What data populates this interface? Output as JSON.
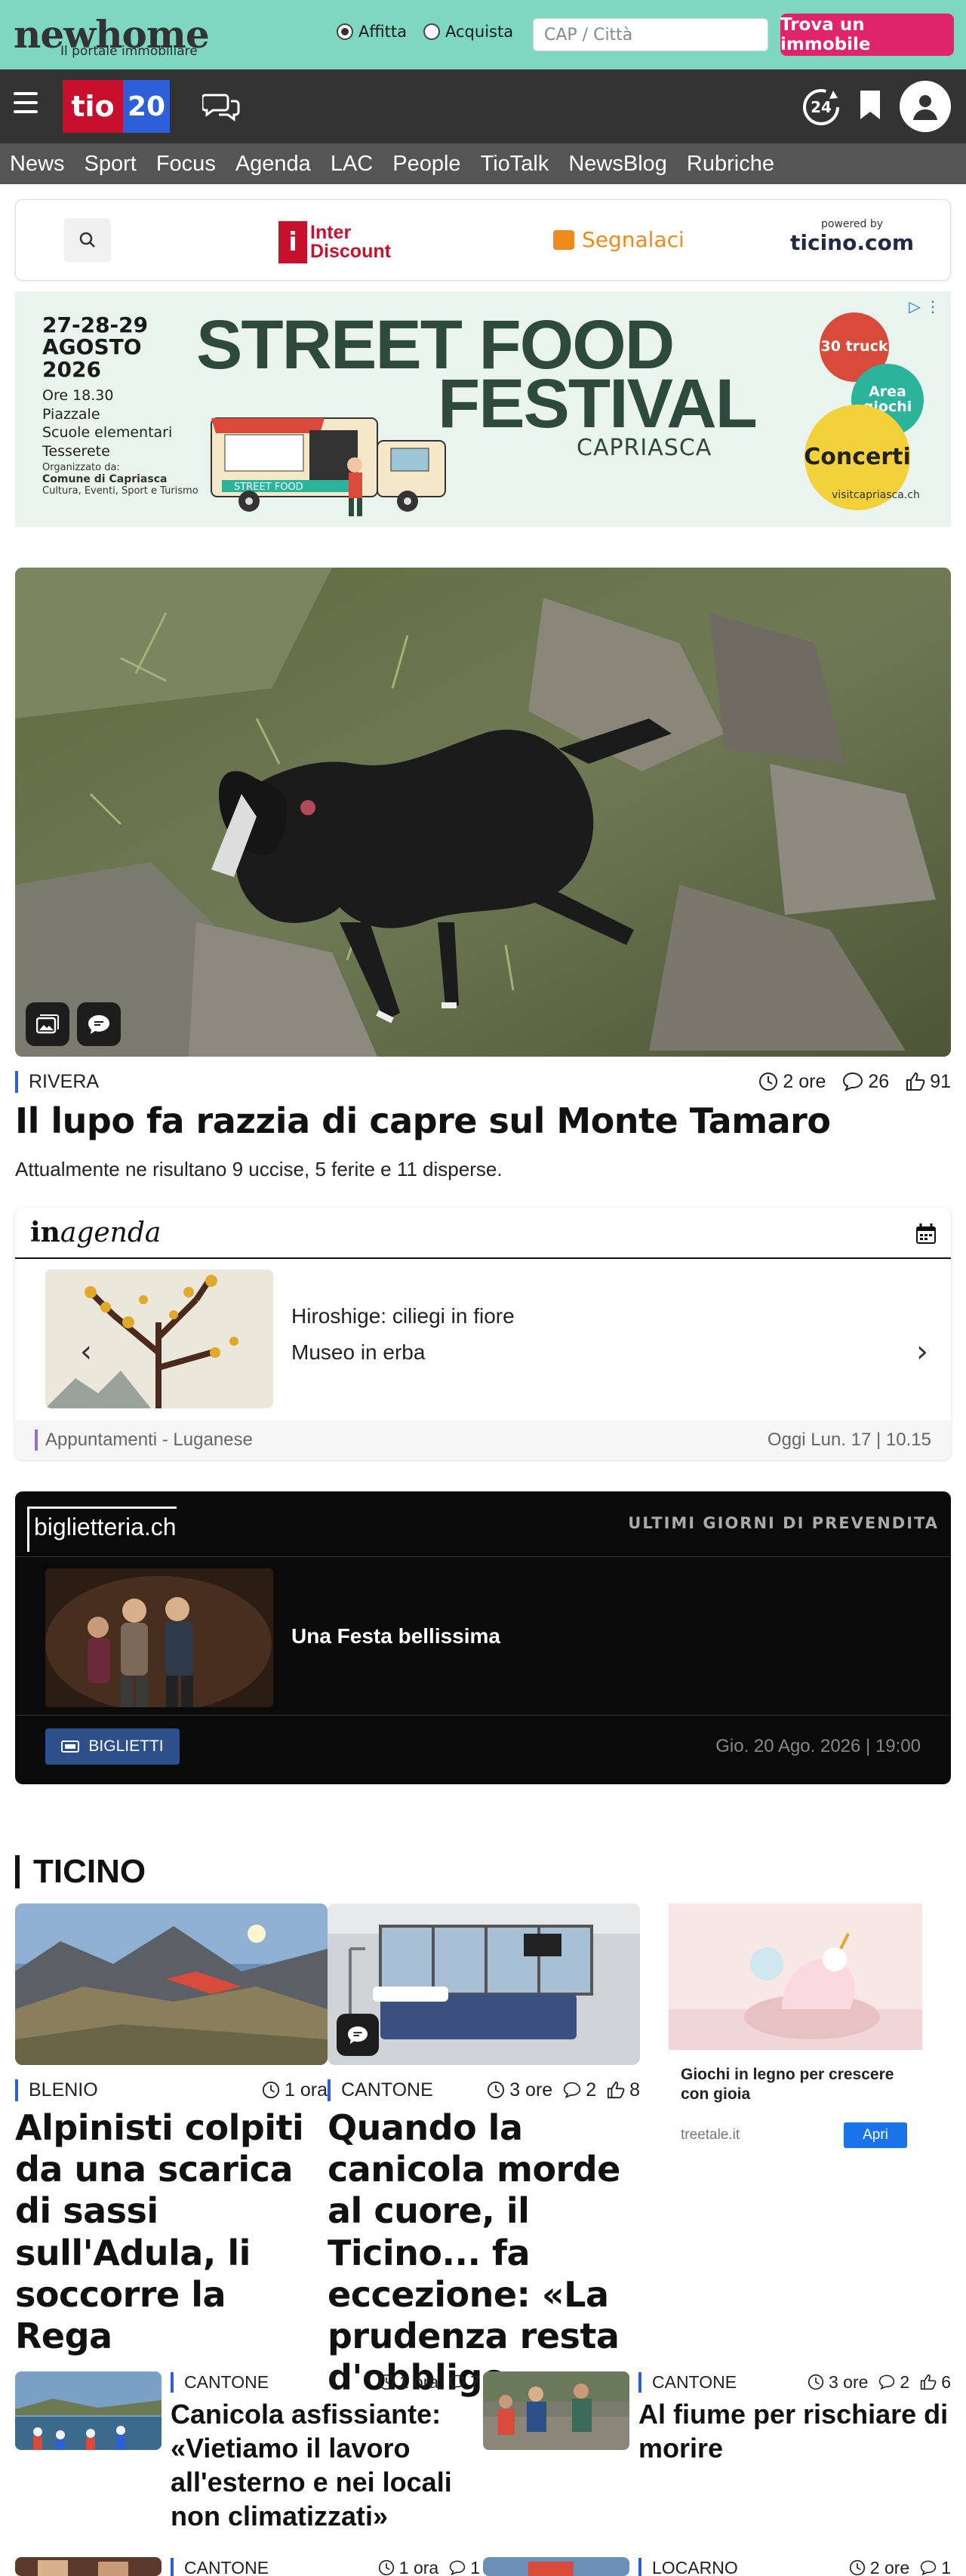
{
  "promo": {
    "logo_text": "newhome",
    "logo_sub": "Il portale immobiliare",
    "radio_rent": "Affitta",
    "radio_buy": "Acquista",
    "search_placeholder": "CAP / Città",
    "cta": "Trova un immobile"
  },
  "header": {
    "brand_left": "tio",
    "brand_right": "20",
    "badge_24": "24"
  },
  "nav": [
    "News",
    "Sport",
    "Focus",
    "Agenda",
    "LAC",
    "People",
    "TioTalk",
    "NewsBlog",
    "Rubriche"
  ],
  "strip": {
    "interdiscount": [
      "Inter",
      "Discount"
    ],
    "segnalaci": "Segnalaci",
    "powered_by": "powered by",
    "powered_brand": "ticino.com"
  },
  "ad": {
    "date": [
      "27-28-29",
      "AGOSTO",
      "2026"
    ],
    "details": [
      "Ore 18.30",
      "Piazzale",
      "Scuole elementari",
      "Tesserete"
    ],
    "organizer": [
      "Organizzato da:",
      "Comune di Capriasca",
      "Cultura, Eventi, Sport e Turismo"
    ],
    "title1": "STREET FOOD",
    "title2": "FESTIVAL",
    "place": "CAPRIASCA",
    "bubble1": "30 truck",
    "bubble2": "Area giochi",
    "bubble3": "Concerti",
    "site": "visitcapriasca.ch",
    "truck_label": "STREET FOOD"
  },
  "hero": {
    "region": "RIVERA",
    "time": "2 ore",
    "comments": "26",
    "likes": "91",
    "title": "Il lupo fa razzia di capre sul Monte Tamaro",
    "lead": "Attualmente ne risultano 9 uccise, 5 ferite e 11 disperse."
  },
  "agenda": {
    "logo_a": "in",
    "logo_b": "agenda",
    "title": "Hiroshige: ciliegi in fiore",
    "venue": "Museo in erba",
    "category": "Appuntamenti - Luganese",
    "date": "Oggi Lun. 17 | 10.15"
  },
  "biglietteria": {
    "logo": "biglietteria.ch",
    "heading": "ULTIMI GIORNI DI PREVENDITA",
    "title": "Una Festa bellissima",
    "button": "BIGLIETTI",
    "date": "Gio. 20 Ago. 2026 | 19:00"
  },
  "ticino": {
    "heading": "TICINO",
    "main": [
      {
        "region": "BLENIO",
        "time": "1 ora",
        "title": "Alpinisti colpiti da una scarica di sassi sull'Adula, li soccorre la Rega"
      },
      {
        "region": "CANTONE",
        "time": "3 ore",
        "comments": "2",
        "likes": "8",
        "title": "Quando la canicola morde al cuore, il Ticino... fa eccezione: «La prudenza resta d'obbligo»"
      }
    ],
    "side_ad": {
      "title": "Giochi in legno per crescere con gioia",
      "domain": "treetale.it",
      "button": "Apri"
    },
    "small": [
      {
        "region": "CANTONE",
        "time": "1 ora",
        "comments": "7",
        "title": "Canicola asfissiante: «Vietiamo il lavoro all'esterno e nei locali non climatizzati»"
      },
      {
        "region": "CANTONE",
        "time": "3 ore",
        "comments": "2",
        "likes": "6",
        "title": "Al fiume per rischiare di morire"
      },
      {
        "region": "CANTONE",
        "time": "1 ora",
        "comments": "1",
        "title": ""
      },
      {
        "region": "LOCARNO",
        "time": "2 ore",
        "comments": "1",
        "title": ""
      }
    ]
  }
}
